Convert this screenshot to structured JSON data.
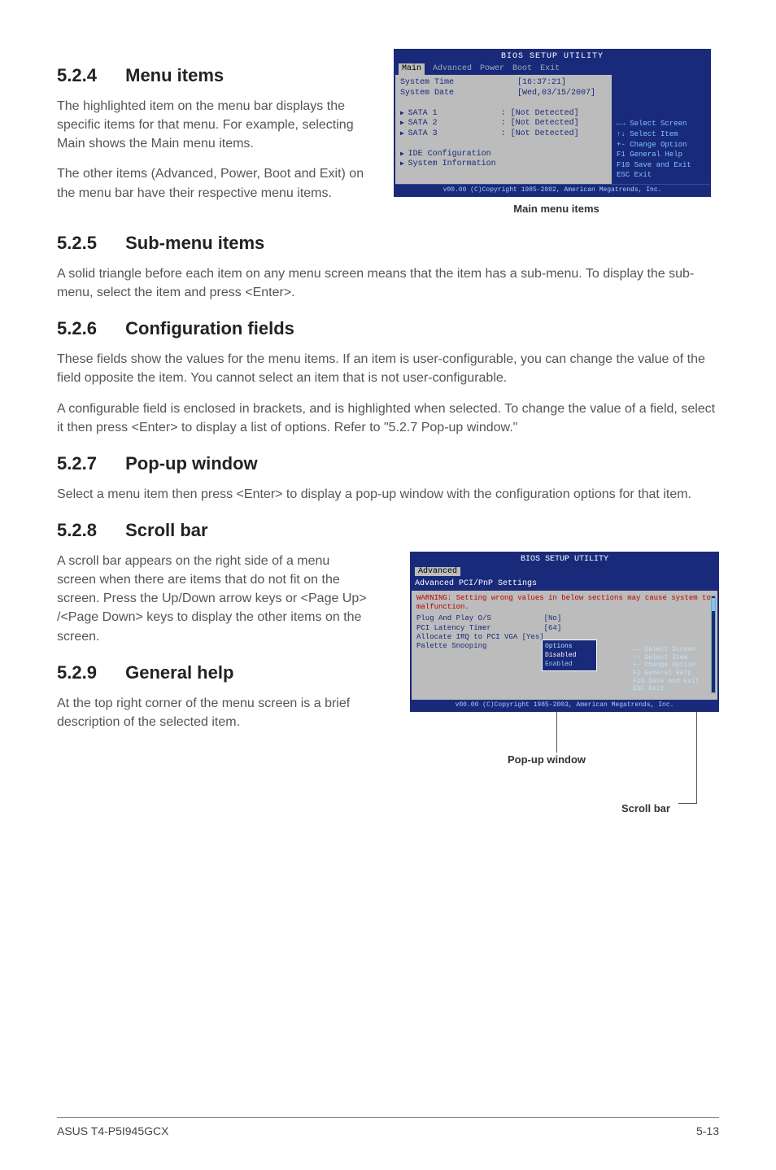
{
  "sections": {
    "s524": {
      "num": "5.2.4",
      "title": "Menu items"
    },
    "s525": {
      "num": "5.2.5",
      "title": "Sub-menu items"
    },
    "s526": {
      "num": "5.2.6",
      "title": "Configuration fields"
    },
    "s527": {
      "num": "5.2.7",
      "title": "Pop-up window"
    },
    "s528": {
      "num": "5.2.8",
      "title": "Scroll bar"
    },
    "s529": {
      "num": "5.2.9",
      "title": "General help"
    }
  },
  "paras": {
    "p524a": "The highlighted item on the menu bar displays the specific items for that menu. For example, selecting Main shows the Main menu items.",
    "p524b": "The other items (Advanced, Power, Boot and Exit) on the menu bar have their respective menu items.",
    "p525": "A solid triangle before each item on any menu screen means that the item has a sub-menu. To display the sub-menu, select the item and press <Enter>.",
    "p526a": "These fields show the values for the menu items. If an item is user-configurable, you can change the value of the field opposite the item. You cannot select an item that is not user-configurable.",
    "p526b": "A configurable field is enclosed in brackets, and is highlighted when selected. To change the value of a field, select it then press <Enter> to display a list of options. Refer to \"5.2.7 Pop-up window.\"",
    "p527": "Select a menu item then press <Enter> to display a pop-up window with the configuration options for that item.",
    "p528": "A scroll bar appears on the right side of a menu screen when there are items that do not fit on the screen. Press the Up/Down arrow keys or <Page Up> /<Page Down> keys to display the other items on the screen.",
    "p529": "At the top right corner of the menu screen is a brief description of the selected item."
  },
  "bios1": {
    "title": "BIOS SETUP UTILITY",
    "tabs": [
      "Main",
      "Advanced",
      "Power",
      "Boot",
      "Exit"
    ],
    "lines": {
      "systime": "System Time             [16:37:21]",
      "sysdate": "System Date             [Wed,03/15/2007]",
      "sata1": "SATA 1             : [Not Detected]",
      "sata2": "SATA 2             : [Not Detected]",
      "sata3": "SATA 3             : [Not Detected]",
      "idecfg": "IDE Configuration",
      "sysinfo": "System Information"
    },
    "legend": {
      "l1": "←→   Select Screen",
      "l2": "↑↓   Select Item",
      "l3": "+-   Change Option",
      "l4": "F1   General Help",
      "l5": "F10  Save and Exit",
      "l6": "ESC  Exit"
    },
    "foot": "v00.00 (C)Copyright 1985-2002, American Megatrends, Inc.",
    "caption": "Main menu items"
  },
  "bios2": {
    "title": "BIOS SETUP UTILITY",
    "tab": "Advanced",
    "header": "Advanced PCI/PnP Settings",
    "warning": "WARNING: Setting wrong values in below sections may cause system to malfunction.",
    "lines": {
      "pnp": "Plug And Play O/S            [No]",
      "lat": "PCI Latency Timer            [64]",
      "irq": "Allocate IRQ to PCI VGA [Yes]",
      "pal": "Palette Snooping"
    },
    "popup": {
      "title": "Options",
      "opt1": "Disabled",
      "opt2": "Enabled"
    },
    "legend": {
      "l1": "←→   Select Screen",
      "l2": "↑↓   Select Item",
      "l3": "+-   Change Option",
      "l4": "F1   General Help",
      "l5": "F10  Save and Exit",
      "l6": "ESC  Exit"
    },
    "foot": "v00.00 (C)Copyright 1985-2003, American Megatrends, Inc."
  },
  "annot": {
    "popup": "Pop-up window",
    "scroll": "Scroll bar"
  },
  "footer": {
    "left": "ASUS T4-P5I945GCX",
    "right": "5-13"
  }
}
